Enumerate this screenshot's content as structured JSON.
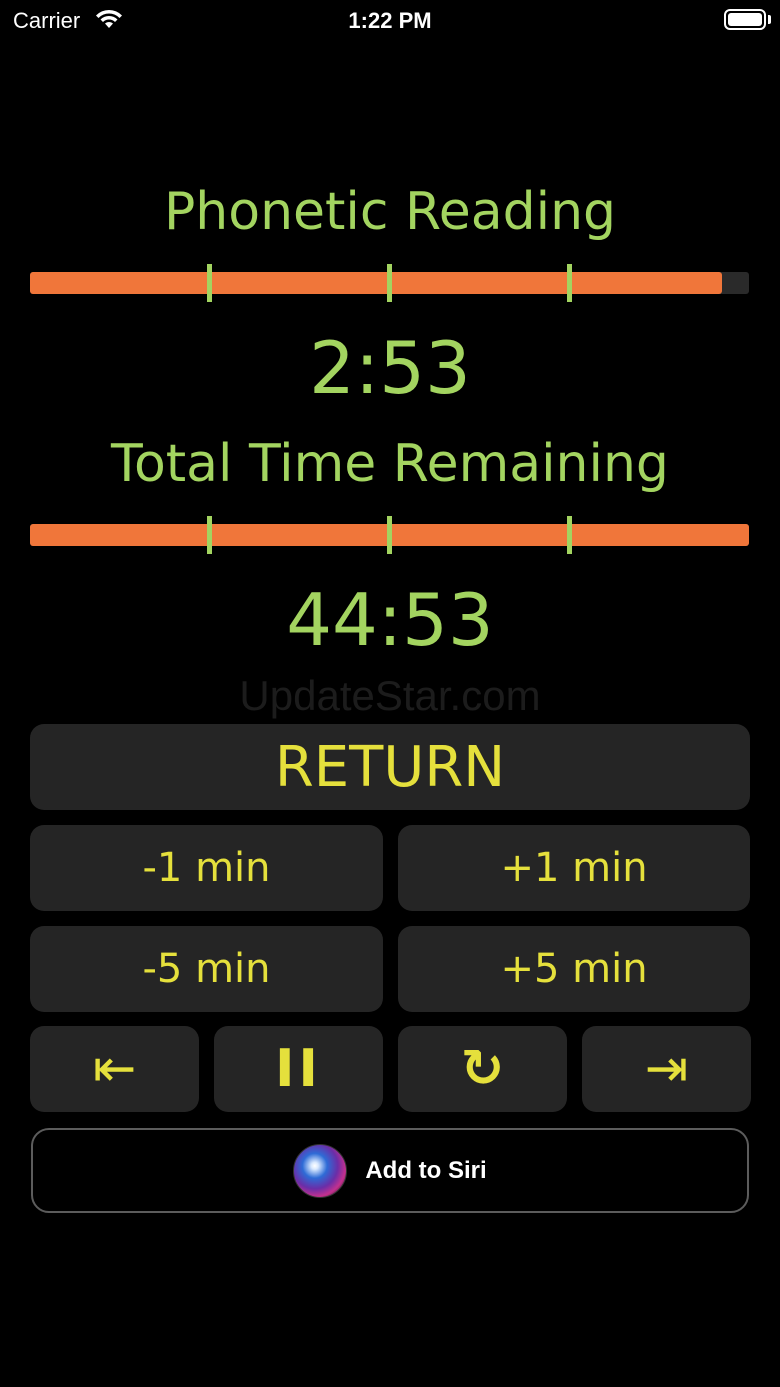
{
  "status_bar": {
    "carrier": "Carrier",
    "time": "1:22 PM"
  },
  "section_1": {
    "title": "Phonetic Reading",
    "time": "2:53",
    "progress": 0.962
  },
  "section_2": {
    "title": "Total Time Remaining",
    "time": "44:53",
    "progress": 1.0
  },
  "watermark": "UpdateStar.com",
  "buttons": {
    "return": "RETURN",
    "minus_1": "-1 min",
    "plus_1": "+1 min",
    "minus_5": "-5 min",
    "plus_5": "+5 min",
    "prev_glyph": "⇤",
    "pause_glyph": "II",
    "restart_glyph": "↻",
    "next_glyph": "⇥"
  },
  "siri": {
    "label": "Add to Siri"
  },
  "colors": {
    "accent_green": "#a3d460",
    "button_yellow": "#e5e03c",
    "progress_orange": "#f0763a",
    "button_bg": "#252525"
  },
  "icons": {
    "wifi": "wifi-icon",
    "battery": "battery-icon",
    "siri": "siri-icon"
  }
}
